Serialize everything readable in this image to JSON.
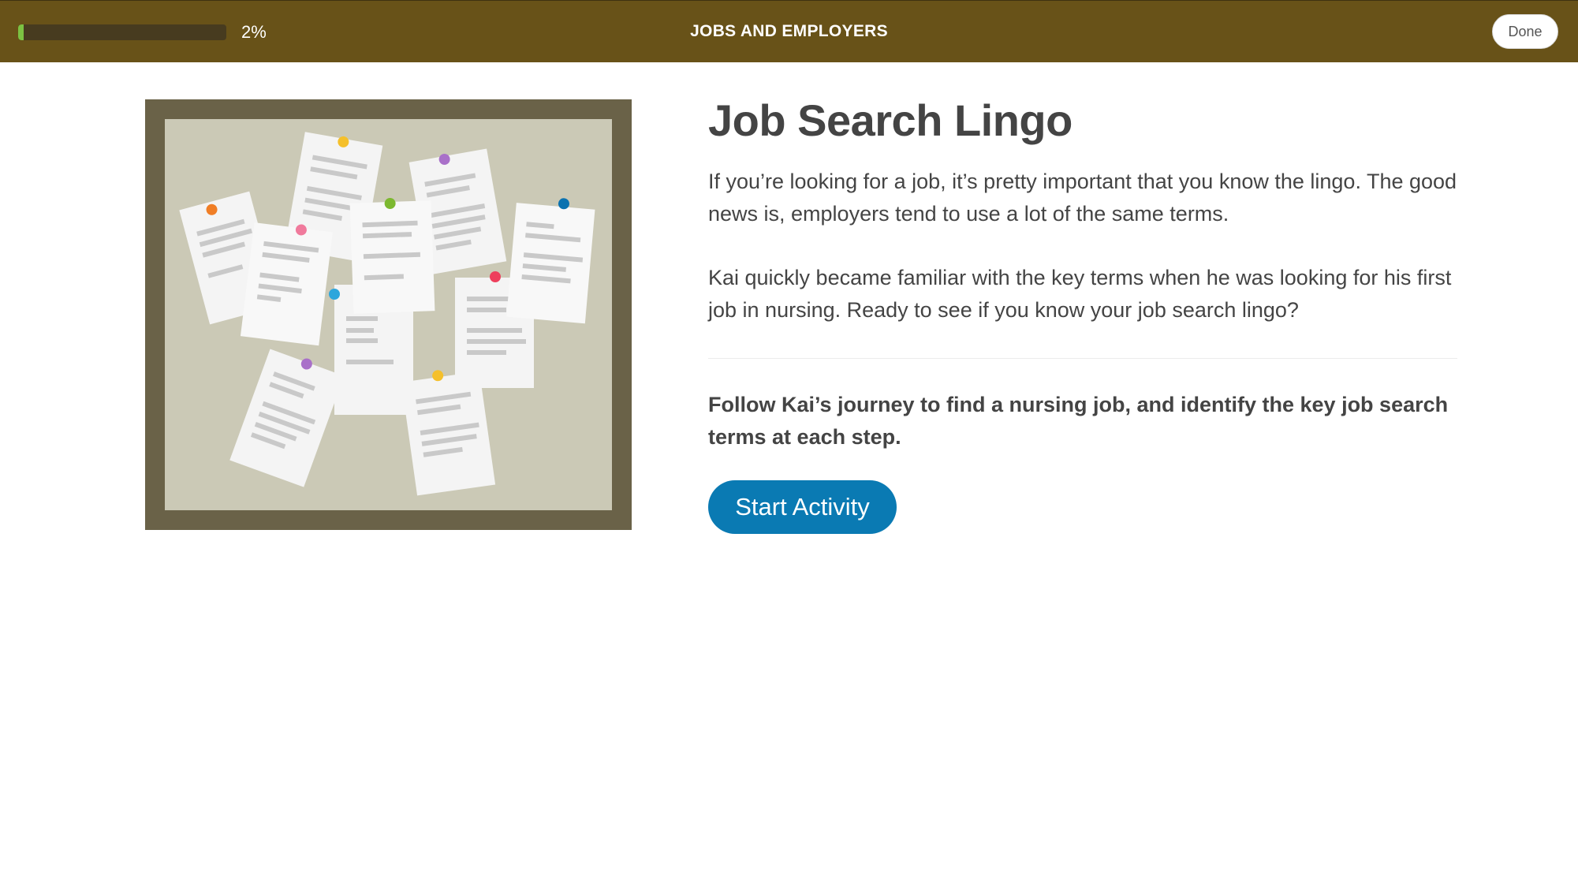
{
  "header": {
    "progress_fraction": 0.02,
    "progress_label": "2%",
    "title": "JOBS AND EMPLOYERS",
    "done_label": "Done"
  },
  "main": {
    "heading": "Job Search Lingo",
    "paragraph_1": "If you’re looking for a job, it’s pretty important that you know the lingo. The good news is, employers tend to use a lot of the same terms.",
    "paragraph_2": "Kai quickly became familiar with the key terms when he was looking for his first job in nursing. Ready to see if you know your job search lingo?",
    "instruction": "Follow Kai’s journey to find a nursing job, and identify the key job search terms at each step.",
    "start_button_label": "Start Activity"
  },
  "colors": {
    "header_bg": "#685218",
    "progress_fill": "#7cc242",
    "accent_button": "#0a7ab3",
    "board_frame": "#6a6248",
    "board_surface": "#cbc9b6"
  },
  "illustration": {
    "icon": "bulletin-board-icon"
  }
}
